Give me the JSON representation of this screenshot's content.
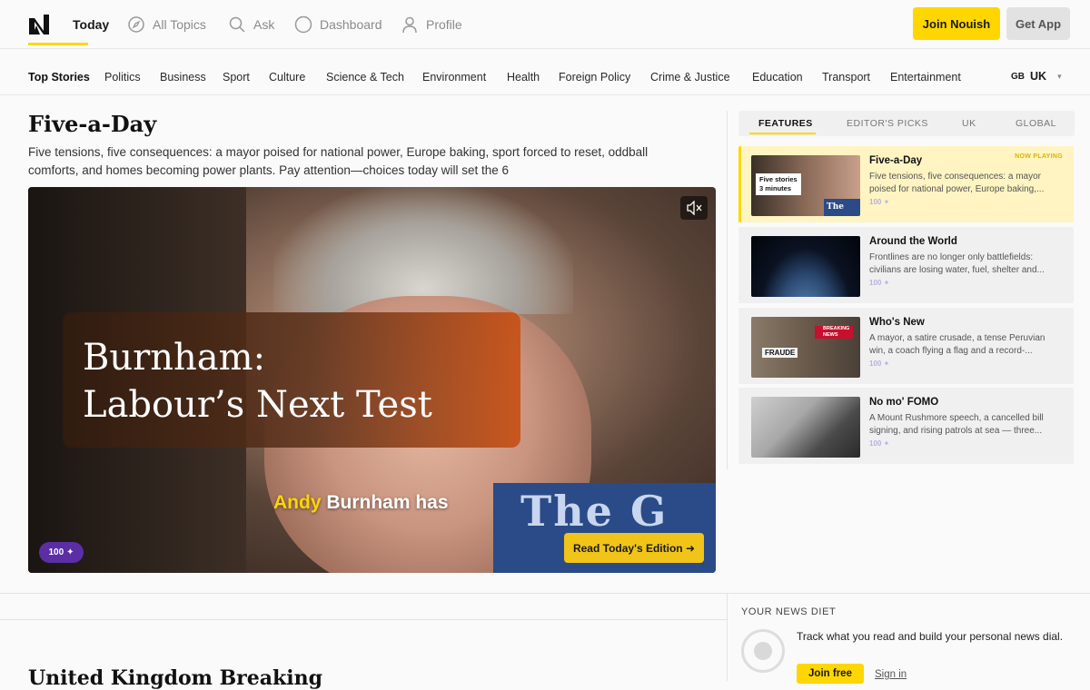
{
  "header": {
    "nav": [
      {
        "label": "Today",
        "icon": "today-icon",
        "active": true
      },
      {
        "label": "All Topics",
        "icon": "compass-icon"
      },
      {
        "label": "Ask",
        "icon": "search-icon"
      },
      {
        "label": "Dashboard",
        "icon": "circle-icon"
      },
      {
        "label": "Profile",
        "icon": "user-icon"
      }
    ],
    "join_label": "Join Nouish",
    "app_label": "Get App"
  },
  "categories": {
    "items": [
      "Top Stories",
      "Politics",
      "Business",
      "Sport",
      "Culture",
      "Science & Tech",
      "Environment",
      "Health",
      "Foreign Policy",
      "Crime & Justice",
      "Education",
      "Transport",
      "Entertainment"
    ],
    "region_flag": "GB",
    "region": "UK"
  },
  "main": {
    "title": "Five-a-Day",
    "description": "Five tensions, five consequences: a mayor poised for national power, Europe baking, sport forced to reset, oddball comforts, and homes becoming power plants. Pay attention—choices today will set the 6",
    "video": {
      "headline": "Burnham:\nLabour’s Next Test",
      "caption_highlight": "Andy",
      "caption_rest": " Burnham has",
      "badge": "100",
      "read_label": "Read Today's Edition ➜",
      "watermark": "The G"
    }
  },
  "side": {
    "tabs": [
      "FEATURES",
      "EDITOR'S PICKS",
      "UK",
      "GLOBAL"
    ],
    "cards": [
      {
        "title": "Five-a-Day",
        "desc": "Five tensions, five consequences: a mayor poised for national power, Europe baking,...",
        "meta": "100",
        "now_playing": "NOW PLAYING",
        "thumb_label": "Five stories",
        "thumb_label2": "3 minutes",
        "thumb_brand": "The Guard"
      },
      {
        "title": "Around the World",
        "desc": "Frontlines are no longer only battlefields: civilians are losing water, fuel, shelter and...",
        "meta": "100"
      },
      {
        "title": "Who's New",
        "desc": "A mayor, a satire crusade, a tense Peruvian win, a coach flying a flag and a record-...",
        "meta": "100",
        "thumb_sign": "FRAUDE",
        "thumb_news": "BREAKING NEWS"
      },
      {
        "title": "No mo' FOMO",
        "desc": "A Mount Rushmore speech, a cancelled bill signing, and rising patrols at sea — three...",
        "meta": "100"
      }
    ]
  },
  "bottom": {
    "section_title": "United Kingdom Breaking",
    "diet": {
      "label": "YOUR NEWS DIET",
      "text": "Track what you read and build your personal news dial.",
      "join_label": "Join free",
      "signin_label": "Sign in"
    }
  }
}
